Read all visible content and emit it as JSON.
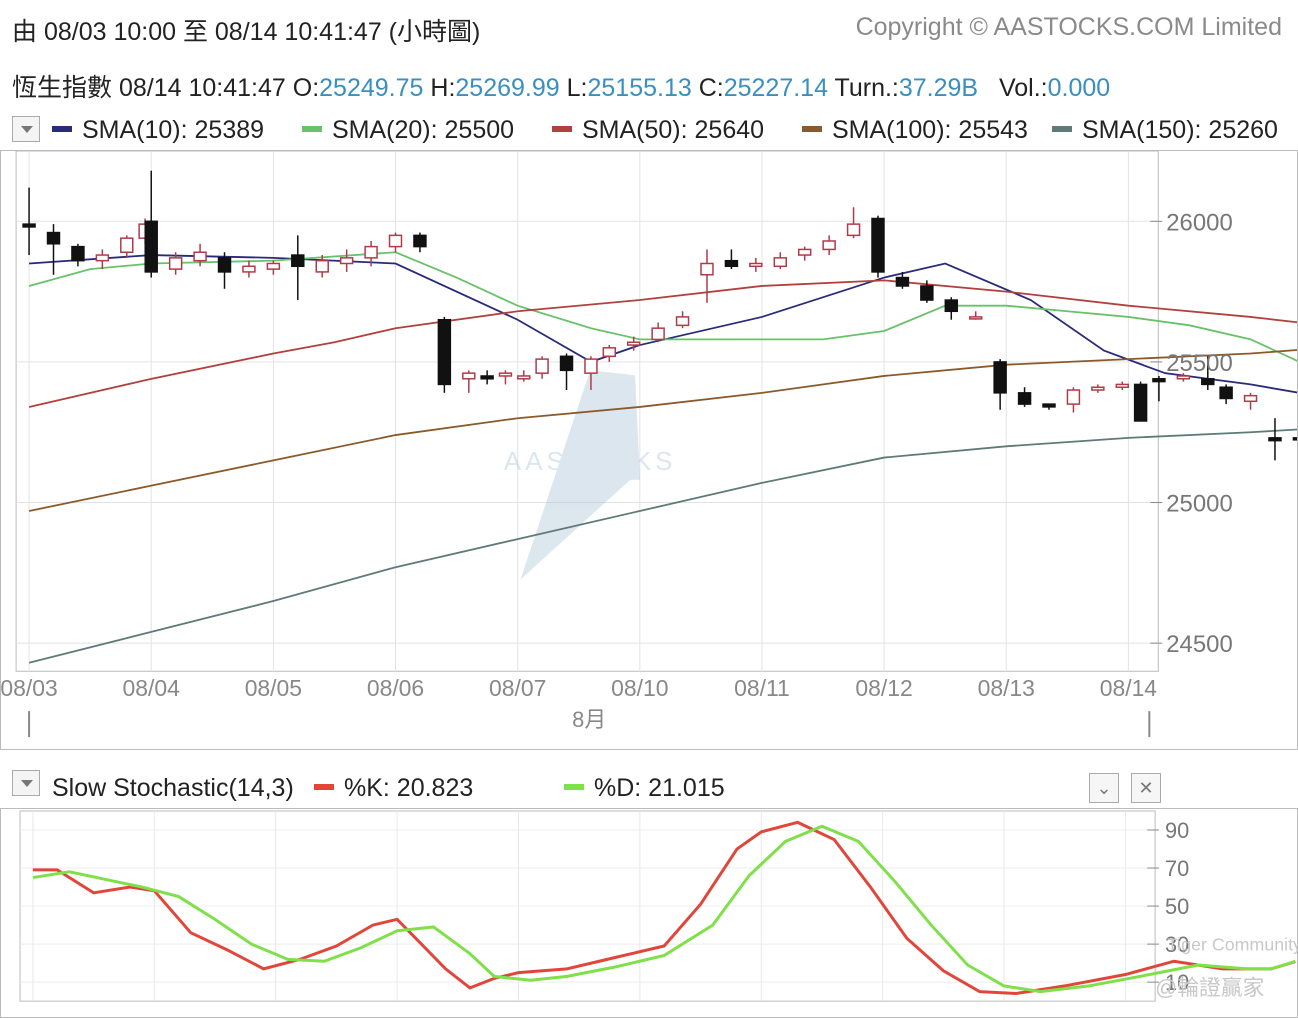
{
  "header": {
    "range": "由 08/03 10:00 至 08/14 10:41:47 (小時圖)",
    "copyright": "Copyright © AASTOCKS.COM Limited"
  },
  "quote": {
    "name": "恆生指數",
    "time": "08/14 10:41:47",
    "open_label": "O:",
    "open": "25249.75",
    "high_label": "H:",
    "high": "25269.99",
    "low_label": "L:",
    "low": "25155.13",
    "close_label": "C:",
    "close": "25227.14",
    "turn_label": "Turn.:",
    "turn": "37.29B",
    "vol_label": "Vol.:",
    "vol": "0.000"
  },
  "sma_legend": [
    {
      "label": "SMA(10): 25389",
      "color": "#2a2a7a"
    },
    {
      "label": "SMA(20): 25500",
      "color": "#69c16a"
    },
    {
      "label": "SMA(50): 25640",
      "color": "#b0413e"
    },
    {
      "label": "SMA(100): 25543",
      "color": "#8b5a2b"
    },
    {
      "label": "SMA(150): 25260",
      "color": "#5f7a78"
    }
  ],
  "stoch_legend": {
    "title": "Slow Stochastic(14,3)",
    "k": "%K: 20.823",
    "k_color": "#e0463a",
    "d": "%D: 21.015",
    "d_color": "#7fe04a"
  },
  "watermark": {
    "logo": "AASTOCKS",
    "tiger": "Tiger Community",
    "user": "@輪證贏家"
  },
  "chart_data": [
    {
      "type": "candlestick",
      "x_ticks": [
        "08/03",
        "08/04",
        "08/05",
        "08/06",
        "08/07",
        "08/10",
        "08/11",
        "08/12",
        "08/13",
        "08/14"
      ],
      "x_sublabel": "8月",
      "y_ticks": [
        26000,
        25500,
        25000,
        24500
      ],
      "ylim": [
        24400,
        26250
      ],
      "candles": [
        [
          0,
          25990,
          25980,
          26120,
          25880
        ],
        [
          0.2,
          25960,
          25920,
          25990,
          25810
        ],
        [
          0.4,
          25910,
          25860,
          25920,
          25840
        ],
        [
          0.6,
          25860,
          25880,
          25900,
          25830
        ],
        [
          0.8,
          25890,
          25940,
          25950,
          25870
        ],
        [
          0.95,
          25940,
          25990,
          26010,
          25920
        ],
        [
          1.0,
          26000,
          25820,
          26180,
          25800
        ],
        [
          1.2,
          25830,
          25870,
          25890,
          25810
        ],
        [
          1.4,
          25860,
          25890,
          25920,
          25840
        ],
        [
          1.6,
          25870,
          25820,
          25890,
          25760
        ],
        [
          1.8,
          25820,
          25840,
          25860,
          25800
        ],
        [
          2.0,
          25830,
          25850,
          25860,
          25810
        ],
        [
          2.2,
          25880,
          25840,
          25950,
          25720
        ],
        [
          2.4,
          25820,
          25860,
          25880,
          25800
        ],
        [
          2.6,
          25850,
          25870,
          25900,
          25820
        ],
        [
          2.8,
          25870,
          25910,
          25930,
          25840
        ],
        [
          3.0,
          25910,
          25950,
          25960,
          25890
        ],
        [
          3.2,
          25950,
          25910,
          25960,
          25890
        ],
        [
          3.4,
          25650,
          25420,
          25660,
          25390
        ],
        [
          3.6,
          25440,
          25460,
          25470,
          25390
        ],
        [
          3.75,
          25450,
          25440,
          25470,
          25420
        ],
        [
          3.9,
          25450,
          25460,
          25470,
          25420
        ],
        [
          4.05,
          25440,
          25450,
          25470,
          25430
        ],
        [
          4.2,
          25460,
          25510,
          25520,
          25440
        ],
        [
          4.4,
          25520,
          25470,
          25530,
          25400
        ],
        [
          4.6,
          25460,
          25510,
          25520,
          25400
        ],
        [
          4.75,
          25520,
          25550,
          25560,
          25500
        ],
        [
          4.95,
          25560,
          25570,
          25590,
          25540
        ],
        [
          5.15,
          25580,
          25620,
          25640,
          25570
        ],
        [
          5.35,
          25630,
          25660,
          25680,
          25620
        ],
        [
          5.55,
          25810,
          25850,
          25900,
          25710
        ],
        [
          5.75,
          25860,
          25840,
          25900,
          25830
        ],
        [
          5.95,
          25840,
          25850,
          25870,
          25820
        ],
        [
          6.15,
          25840,
          25870,
          25890,
          25830
        ],
        [
          6.35,
          25880,
          25900,
          25910,
          25860
        ],
        [
          6.55,
          25900,
          25930,
          25950,
          25880
        ],
        [
          6.75,
          25950,
          25990,
          26050,
          25940
        ],
        [
          6.95,
          26010,
          25820,
          26020,
          25800
        ],
        [
          7.15,
          25800,
          25770,
          25820,
          25760
        ],
        [
          7.35,
          25770,
          25720,
          25790,
          25710
        ],
        [
          7.55,
          25720,
          25680,
          25730,
          25650
        ],
        [
          7.75,
          25660,
          25660,
          25680,
          25650
        ],
        [
          7.95,
          25500,
          25390,
          25510,
          25330
        ],
        [
          8.15,
          25390,
          25350,
          25410,
          25340
        ],
        [
          8.35,
          25350,
          25340,
          25350,
          25330
        ],
        [
          8.55,
          25350,
          25400,
          25410,
          25320
        ],
        [
          8.75,
          25400,
          25410,
          25420,
          25390
        ],
        [
          8.95,
          25410,
          25420,
          25430,
          25400
        ],
        [
          9.1,
          25420,
          25290,
          25430,
          25290
        ],
        [
          9.25,
          25440,
          25430,
          25450,
          25360
        ],
        [
          9.45,
          25440,
          25450,
          25460,
          25430
        ],
        [
          9.65,
          25440,
          25420,
          25520,
          25400
        ],
        [
          9.8,
          25410,
          25370,
          25420,
          25350
        ],
        [
          10.0,
          25360,
          25380,
          25390,
          25330
        ],
        [
          10.2,
          25230,
          25220,
          25300,
          25150
        ],
        [
          10.4,
          25230,
          25227,
          25250,
          25155
        ]
      ],
      "series": [
        {
          "name": "SMA(10)",
          "color": "#2a2a7a",
          "points": [
            [
              0,
              25850
            ],
            [
              1,
              25880
            ],
            [
              2,
              25870
            ],
            [
              3,
              25850
            ],
            [
              4,
              25650
            ],
            [
              4.6,
              25500
            ],
            [
              5,
              25560
            ],
            [
              6,
              25660
            ],
            [
              7,
              25800
            ],
            [
              7.5,
              25850
            ],
            [
              8.2,
              25720
            ],
            [
              8.8,
              25540
            ],
            [
              9.3,
              25460
            ],
            [
              10,
              25420
            ],
            [
              10.4,
              25390
            ]
          ]
        },
        {
          "name": "SMA(20)",
          "color": "#69c16a",
          "points": [
            [
              0,
              25770
            ],
            [
              0.5,
              25830
            ],
            [
              1,
              25850
            ],
            [
              2,
              25860
            ],
            [
              3,
              25890
            ],
            [
              3.5,
              25800
            ],
            [
              4,
              25700
            ],
            [
              4.6,
              25620
            ],
            [
              5,
              25580
            ],
            [
              6,
              25580
            ],
            [
              6.5,
              25580
            ],
            [
              7,
              25610
            ],
            [
              7.5,
              25700
            ],
            [
              8,
              25700
            ],
            [
              8.5,
              25680
            ],
            [
              9,
              25660
            ],
            [
              9.5,
              25630
            ],
            [
              10,
              25580
            ],
            [
              10.4,
              25500
            ]
          ]
        },
        {
          "name": "SMA(50)",
          "color": "#b0413e",
          "points": [
            [
              0,
              25340
            ],
            [
              1,
              25440
            ],
            [
              2,
              25530
            ],
            [
              2.5,
              25570
            ],
            [
              3,
              25620
            ],
            [
              4,
              25680
            ],
            [
              5,
              25720
            ],
            [
              6,
              25770
            ],
            [
              7,
              25790
            ],
            [
              8,
              25750
            ],
            [
              9,
              25700
            ],
            [
              10,
              25660
            ],
            [
              10.4,
              25640
            ]
          ]
        },
        {
          "name": "SMA(100)",
          "color": "#8b5a2b",
          "points": [
            [
              0,
              24970
            ],
            [
              1,
              25060
            ],
            [
              2,
              25150
            ],
            [
              3,
              25240
            ],
            [
              4,
              25300
            ],
            [
              5,
              25340
            ],
            [
              6,
              25390
            ],
            [
              7,
              25450
            ],
            [
              8,
              25490
            ],
            [
              9,
              25510
            ],
            [
              10,
              25530
            ],
            [
              10.4,
              25543
            ]
          ]
        },
        {
          "name": "SMA(150)",
          "color": "#5f7a78",
          "points": [
            [
              0,
              24430
            ],
            [
              1,
              24540
            ],
            [
              2,
              24650
            ],
            [
              3,
              24770
            ],
            [
              4,
              24870
            ],
            [
              5,
              24970
            ],
            [
              6,
              25070
            ],
            [
              7,
              25160
            ],
            [
              8,
              25200
            ],
            [
              9,
              25230
            ],
            [
              10,
              25250
            ],
            [
              10.4,
              25260
            ]
          ]
        }
      ]
    },
    {
      "type": "line",
      "title": "Slow Stochastic(14,3)",
      "y_ticks": [
        90,
        70,
        50,
        30,
        10
      ],
      "ylim": [
        0,
        100
      ],
      "series": [
        {
          "name": "%K",
          "color": "#e0463a",
          "points": [
            [
              0,
              69
            ],
            [
              0.2,
              69
            ],
            [
              0.5,
              57
            ],
            [
              0.8,
              60
            ],
            [
              1.0,
              58
            ],
            [
              1.3,
              36
            ],
            [
              1.6,
              27
            ],
            [
              1.9,
              17
            ],
            [
              2.2,
              22
            ],
            [
              2.5,
              29
            ],
            [
              2.8,
              40
            ],
            [
              3.0,
              43
            ],
            [
              3.2,
              30
            ],
            [
              3.4,
              17
            ],
            [
              3.6,
              7
            ],
            [
              3.8,
              12
            ],
            [
              4.0,
              15
            ],
            [
              4.4,
              17
            ],
            [
              4.8,
              23
            ],
            [
              5.2,
              29
            ],
            [
              5.5,
              51
            ],
            [
              5.8,
              80
            ],
            [
              6.0,
              89
            ],
            [
              6.3,
              94
            ],
            [
              6.6,
              85
            ],
            [
              6.9,
              60
            ],
            [
              7.2,
              33
            ],
            [
              7.5,
              16
            ],
            [
              7.8,
              5
            ],
            [
              8.1,
              4
            ],
            [
              8.5,
              8
            ],
            [
              9.0,
              14
            ],
            [
              9.4,
              21
            ],
            [
              9.8,
              17
            ],
            [
              10.2,
              17
            ],
            [
              10.4,
              20.8
            ]
          ]
        },
        {
          "name": "%D",
          "color": "#7fe04a",
          "points": [
            [
              0,
              65
            ],
            [
              0.3,
              68
            ],
            [
              0.6,
              64
            ],
            [
              0.9,
              60
            ],
            [
              1.2,
              55
            ],
            [
              1.5,
              43
            ],
            [
              1.8,
              30
            ],
            [
              2.1,
              22
            ],
            [
              2.4,
              21
            ],
            [
              2.7,
              28
            ],
            [
              3.0,
              37
            ],
            [
              3.3,
              39
            ],
            [
              3.6,
              25
            ],
            [
              3.8,
              13
            ],
            [
              4.1,
              11
            ],
            [
              4.4,
              13
            ],
            [
              4.8,
              18
            ],
            [
              5.2,
              24
            ],
            [
              5.6,
              40
            ],
            [
              5.9,
              66
            ],
            [
              6.2,
              84
            ],
            [
              6.5,
              92
            ],
            [
              6.8,
              84
            ],
            [
              7.1,
              63
            ],
            [
              7.4,
              40
            ],
            [
              7.7,
              19
            ],
            [
              8.0,
              8
            ],
            [
              8.3,
              5
            ],
            [
              8.7,
              8
            ],
            [
              9.2,
              14
            ],
            [
              9.6,
              19
            ],
            [
              10.0,
              17
            ],
            [
              10.2,
              17
            ],
            [
              10.4,
              21.0
            ]
          ]
        }
      ]
    }
  ]
}
